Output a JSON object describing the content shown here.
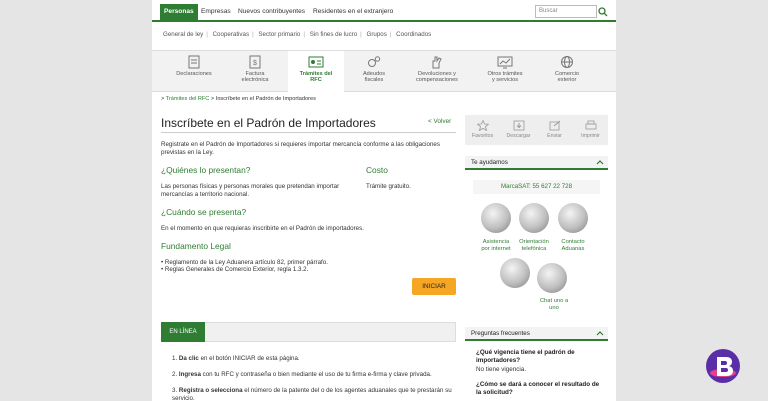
{
  "topnav": {
    "tabs": [
      "Personas",
      "Empresas",
      "Nuevos contribuyentes",
      "Residentes en el extranjero"
    ],
    "search_placeholder": "Buscar"
  },
  "subnav": [
    "General de ley",
    "Cooperativas",
    "Sector primario",
    "Sin fines de lucro",
    "Grupos",
    "Coordinados"
  ],
  "categories": [
    {
      "label1": "Declaraciones",
      "label2": "",
      "icon": "document-icon"
    },
    {
      "label1": "Factura",
      "label2": "electrónica",
      "icon": "invoice-icon"
    },
    {
      "label1": "Trámites del",
      "label2": "RFC",
      "icon": "id-card-icon"
    },
    {
      "label1": "Adeudos",
      "label2": "fiscales",
      "icon": "gears-icon"
    },
    {
      "label1": "Devoluciones y",
      "label2": "compensaciones",
      "icon": "hand-icon"
    },
    {
      "label1": "Otros trámites",
      "label2": "y servicios",
      "icon": "monitor-icon"
    },
    {
      "label1": "Comercio",
      "label2": "exterior",
      "icon": "globe-icon"
    }
  ],
  "breadcrumb": {
    "link": "Trámites del RFC",
    "current": "Inscríbete en el Padrón de Importadores",
    "prefix": ">",
    "sep": ">"
  },
  "main": {
    "title": "Inscríbete en el Padrón de Importadores",
    "volver": "< Volver",
    "intro": "Registrate en el Padrón de Importadores si requieres importar mercancía conforme a las obligaciones previstas en la Ley.",
    "quienes_title": "¿Quiénes lo presentan?",
    "quienes_text": "Las personas físicas y personas morales que pretendan importar mercancías a territorio nacional.",
    "costo_title": "Costo",
    "costo_text": "Trámite gratuito.",
    "cuando_title": "¿Cuándo se presenta?",
    "cuando_text": "En el momento en que requieras inscribirte en el Padrón de importadores.",
    "fundamento_title": "Fundamento Legal",
    "fundamento_1": "• Reglamento de la Ley Aduanera artículo 82, primer párrafo.",
    "fundamento_2": "• Reglas Generales de Comercio Exterior, regla 1.3.2.",
    "iniciar": "INICIAR",
    "en_linea": "EN LÍNEA",
    "steps": [
      {
        "num": "1.",
        "bold": "Da clic",
        "rest": " en el botón INICIAR de esta página."
      },
      {
        "num": "2.",
        "bold": "Ingresa",
        "rest": " con tu RFC y contraseña o bien mediante el uso de tu firma e-firma y clave privada."
      },
      {
        "num": "3.",
        "bold": "Registra o selecciona",
        "rest": " el número de la patente del o de los agentes aduanales que te prestarán su servicio."
      }
    ]
  },
  "actions": [
    "Favoritos",
    "Descargar",
    "Enviar",
    "Imprimir"
  ],
  "help": {
    "title": "Te ayudamos",
    "phone": "MarcaSAT: 55 627 22 728",
    "items": [
      {
        "l1": "Asistencia",
        "l2": "por internet"
      },
      {
        "l1": "Orientación",
        "l2": "telefónica"
      },
      {
        "l1": "Contacto",
        "l2": "Aduanas"
      },
      {
        "l1": "Chat uno a",
        "l2": "uno"
      }
    ]
  },
  "faq": {
    "title": "Preguntas frecuentes",
    "q1": "¿Qué vigencia tiene el padrón de importadores?",
    "a1": "No tiene vigencia.",
    "q2": "¿Cómo se dará a conocer el resultado de la solicitud?"
  },
  "colors": {
    "brand_green": "#2e7d32",
    "accent_orange": "#f5a623"
  }
}
